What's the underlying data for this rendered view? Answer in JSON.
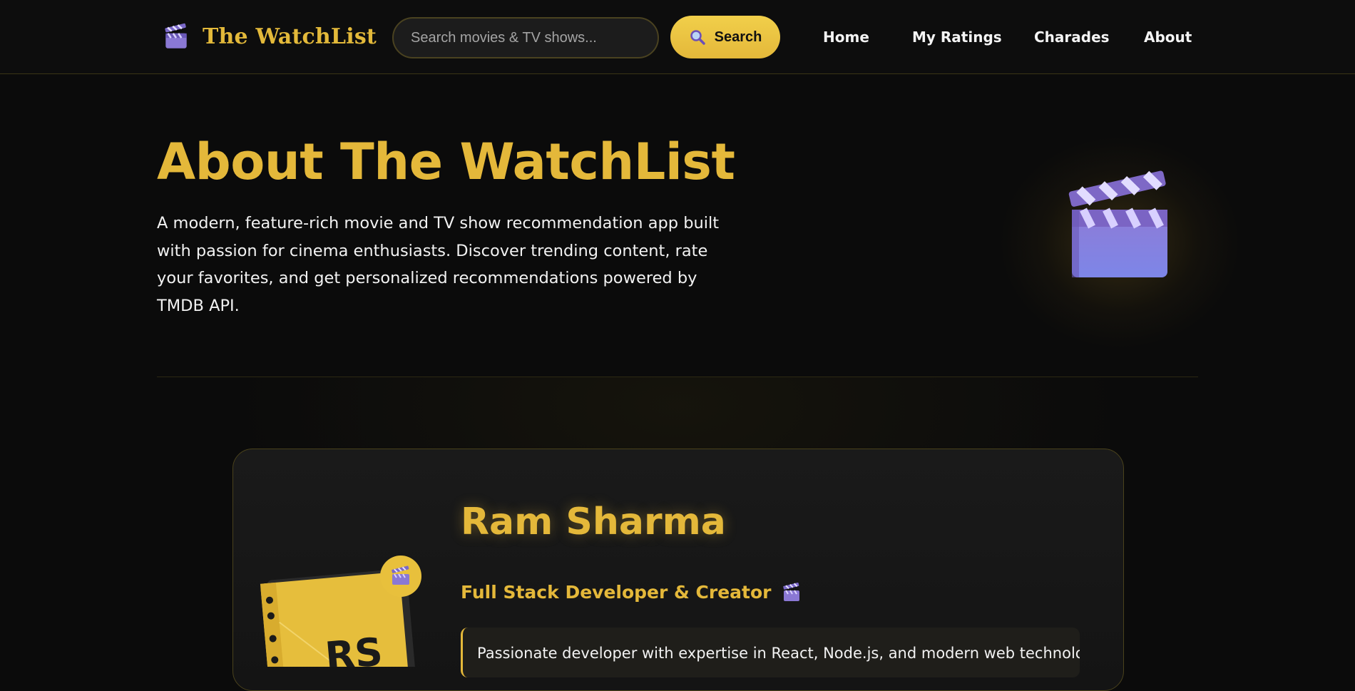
{
  "brand": {
    "title": "The WatchList",
    "icon": "clapperboard-icon"
  },
  "search": {
    "placeholder": "Search movies & TV shows...",
    "value": "",
    "button_label": "Search",
    "button_icon": "magnifier-icon"
  },
  "nav": {
    "items": [
      {
        "label": "Home"
      },
      {
        "label": "My Ratings"
      },
      {
        "label": "Charades"
      },
      {
        "label": "About"
      }
    ]
  },
  "hero": {
    "title": "About The WatchList",
    "description": "A modern, feature-rich movie and TV show recommendation app built with passion for cinema enthusiasts. Discover trending content, rate your favorites, and get personalized recommendations powered by TMDB API.",
    "illustration": "clapperboard-icon"
  },
  "profile": {
    "name": "Ram Sharma",
    "role": "Full Stack Developer & Creator",
    "role_icon": "clapperboard-icon",
    "initials": "RS",
    "bio": "Passionate developer with expertise in React, Node.js, and modern web technologies."
  },
  "colors": {
    "accent": "#e4b83a",
    "background": "#0b0b0b",
    "clapper_purple": "#8a78d4"
  }
}
